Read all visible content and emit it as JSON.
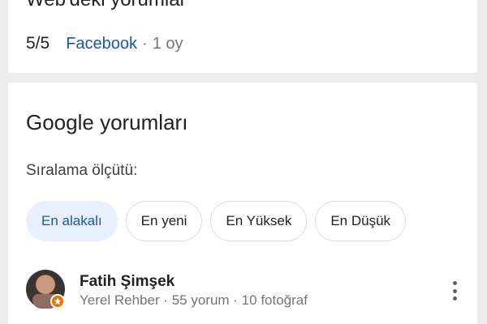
{
  "web_reviews": {
    "title": "Web'deki yorumlar",
    "rating": "5/5",
    "source": "Facebook",
    "separator": "·",
    "time": "1 oy"
  },
  "google_reviews": {
    "title": "Google yorumları",
    "sort_label": "Sıralama ölçütü:",
    "chips": [
      {
        "label": "En alakalı",
        "selected": true
      },
      {
        "label": "En yeni",
        "selected": false
      },
      {
        "label": "En Yüksek",
        "selected": false
      },
      {
        "label": "En Düşük",
        "selected": false
      }
    ]
  },
  "review": {
    "name": "Fatih Şimşek",
    "meta": "Yerel Rehber · 55 yorum · 10 fotoğraf",
    "avatar_icon": "avatar",
    "badge_icon": "local-guide-star-icon",
    "more_icon": "more-vert-icon"
  },
  "colors": {
    "link": "#1a56a8",
    "chip_selected_bg": "#e8f0fe",
    "badge": "#e37400",
    "divider": "#ececec"
  }
}
